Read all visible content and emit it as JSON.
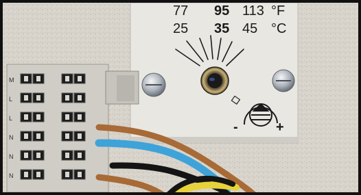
{
  "scale_fahrenheit": {
    "values": [
      "77",
      "95",
      "113"
    ],
    "unit": "°F"
  },
  "scale_celsius": {
    "values": [
      "25",
      "35",
      "45"
    ],
    "unit": "°C"
  },
  "adjust_signs": {
    "minus": "-",
    "plus": "+"
  },
  "terminal_markings": [
    "M",
    "L",
    "L",
    "N",
    "N",
    "N"
  ],
  "colors": {
    "wall": "#d7d3cb",
    "plate": "#e8e6e1",
    "terminal_block": "#cfccc5",
    "wire_blue": "#3ea3d8",
    "wire_brown": "#a86a36",
    "wire_black": "#141414",
    "wire_yellow": "#e7d23a"
  }
}
